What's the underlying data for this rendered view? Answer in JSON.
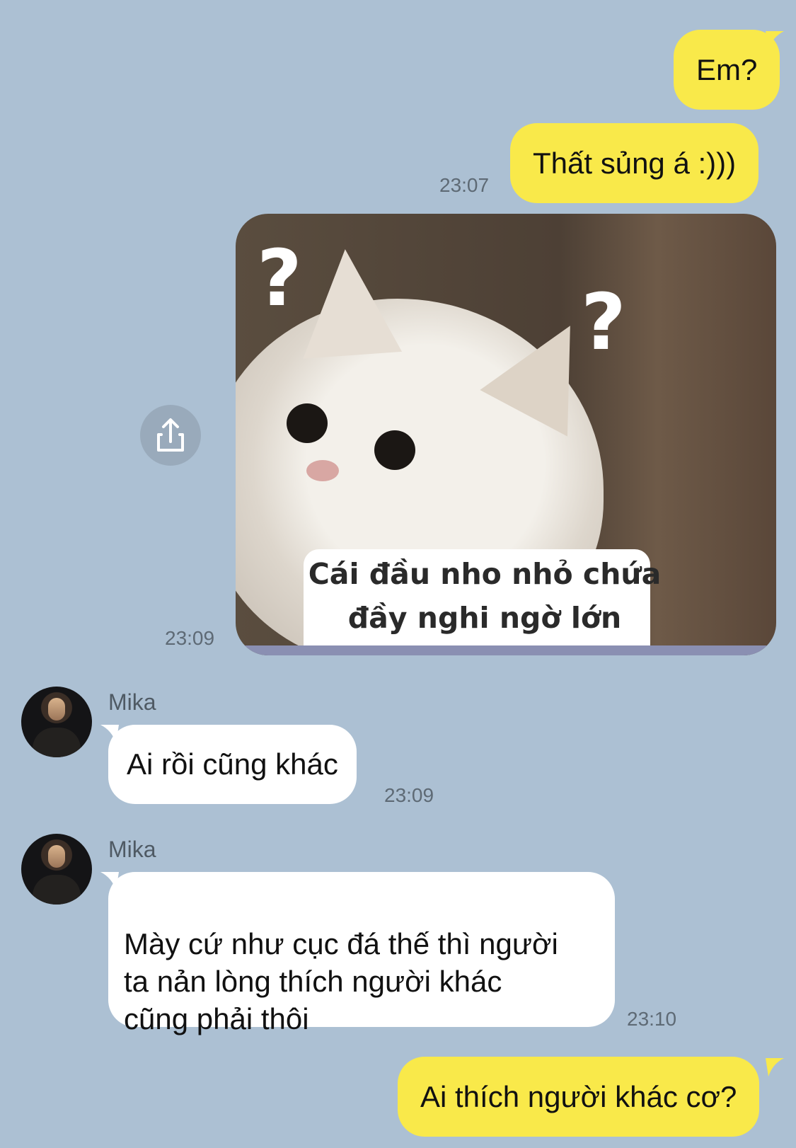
{
  "colors": {
    "background": "#acc0d3",
    "outgoing_bubble": "#f9e94a",
    "incoming_bubble": "#ffffff"
  },
  "messages": [
    {
      "from": "me",
      "text": "Em?"
    },
    {
      "from": "me",
      "text": "Thất sủng á :)))",
      "time": "23:07"
    },
    {
      "from": "me",
      "type": "sticker",
      "caption": "Cái đầu nho nhỏ chứa\nđầy nghi ngờ lớn",
      "time": "23:09",
      "share_icon": "share-icon"
    },
    {
      "from": "Mika",
      "sender_name": "Mika",
      "text": "Ai rồi cũng khác",
      "time": "23:09"
    },
    {
      "from": "Mika",
      "sender_name": "Mika",
      "text": "Mày cứ như cục đá thế thì người\nta nản lòng thích người khác\ncũng phải thôi",
      "time": "23:10"
    },
    {
      "from": "me",
      "text": "Ai thích người khác cơ?"
    }
  ]
}
